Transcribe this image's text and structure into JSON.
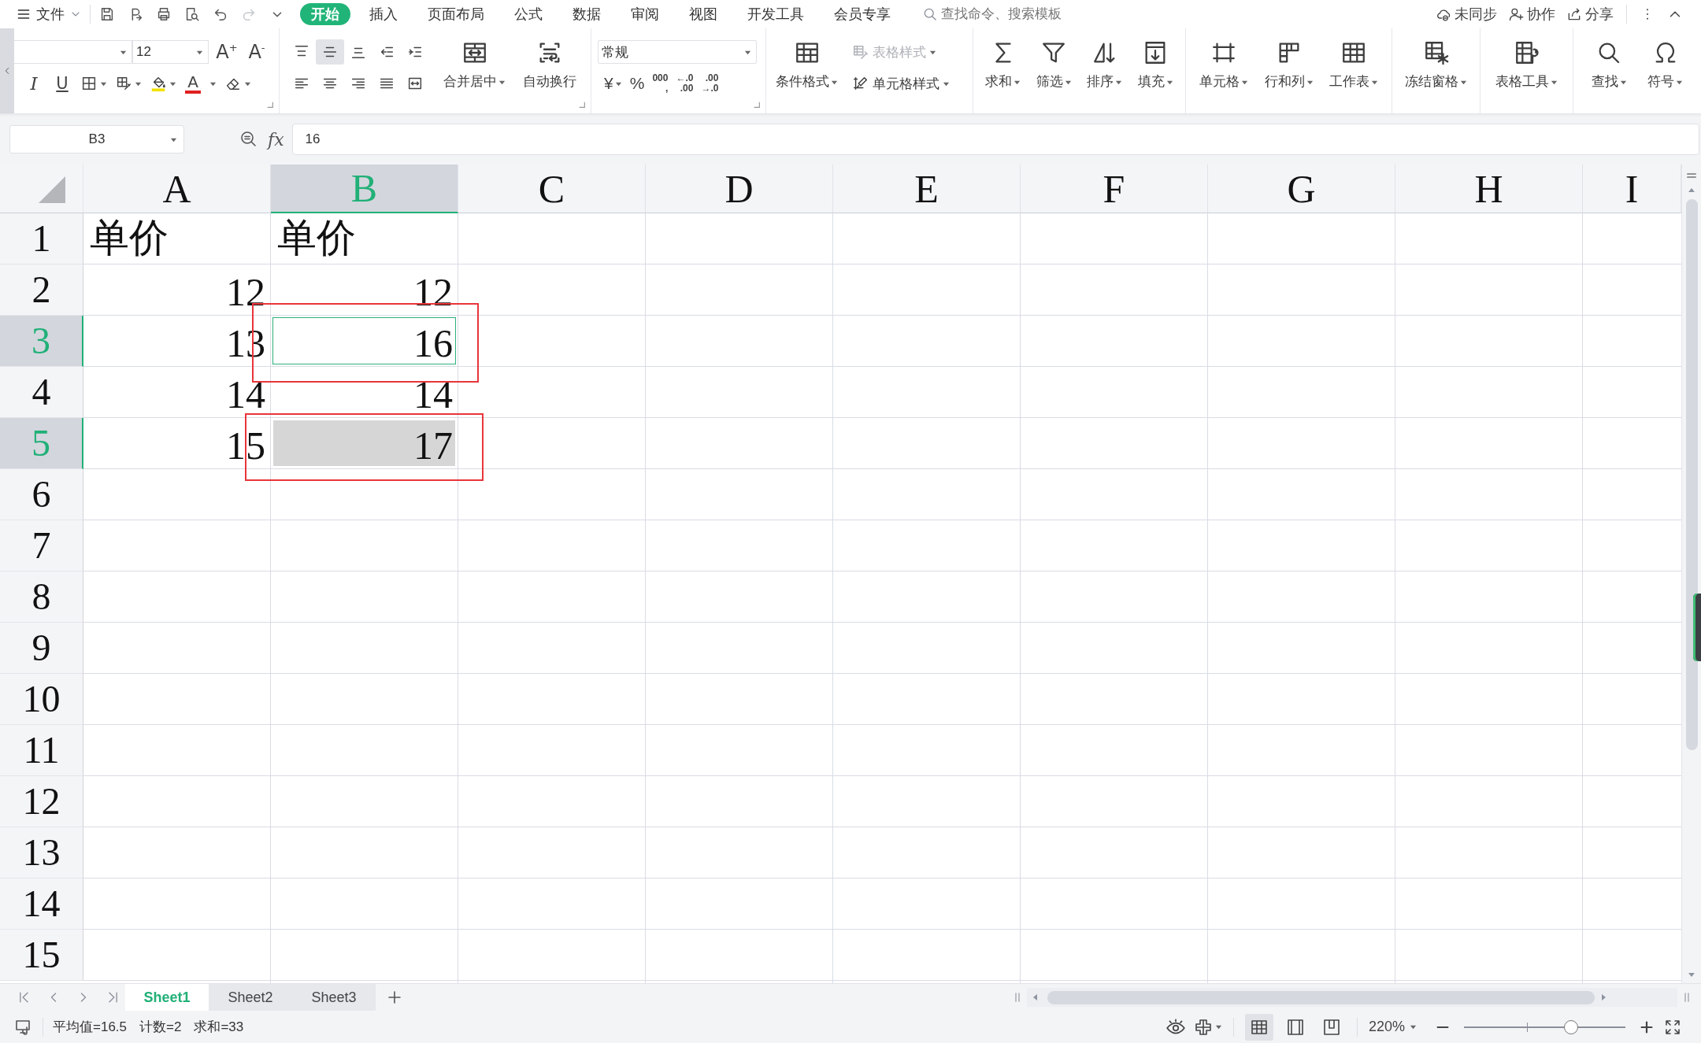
{
  "menu_bar": {
    "menu_label": "文件",
    "quick_access": [
      {
        "disabled": false
      },
      {
        "disabled": false
      },
      {
        "disabled": false
      },
      {
        "disabled": false
      },
      {
        "disabled": false
      },
      {
        "disabled": true
      },
      {
        "disabled": false
      }
    ],
    "tabs": [
      {
        "label": "开始",
        "selected": true
      },
      {
        "label": "插入",
        "selected": false
      },
      {
        "label": "页面布局",
        "selected": false
      },
      {
        "label": "公式",
        "selected": false
      },
      {
        "label": "数据",
        "selected": false
      },
      {
        "label": "审阅",
        "selected": false
      },
      {
        "label": "视图",
        "selected": false
      },
      {
        "label": "开发工具",
        "selected": false
      },
      {
        "label": "会员专享",
        "selected": false
      }
    ],
    "search": {
      "placeholder": "查找命令、搜索模板"
    },
    "actions": [
      {
        "label": "未同步"
      },
      {
        "label": "协作"
      },
      {
        "label": "分享"
      }
    ]
  },
  "ribbon": {
    "font_size": "12",
    "grow_font": "A$^{+}$",
    "shrink_font": "A$^{-}$",
    "italic": "I",
    "underline": "U",
    "font_color": "A",
    "align_buttons": [
      {
        "selected": false
      },
      {
        "selected": true
      },
      {
        "selected": false
      },
      {
        "selected": false
      },
      {
        "selected": false
      },
      {
        "selected": false
      },
      {
        "selected": false
      },
      {
        "selected": false
      },
      {
        "selected": false
      },
      {
        "selected": false
      }
    ],
    "merge_buttons": [
      {
        "label": "合并居中",
        "dropdown": true
      },
      {
        "label": "自动换行",
        "dropdown": false
      }
    ],
    "number_format": "常规",
    "number_buttons": [
      {
        "lines": [
          "¥"
        ],
        "dropdown": true
      },
      {
        "lines": [
          "%"
        ],
        "dropdown": false
      },
      {
        "lines": [
          "000",
          ","
        ],
        "dropdown": false
      },
      {
        "lines": [
          "←.0",
          ".00"
        ],
        "dropdown": false
      },
      {
        "lines": [
          ".00",
          "→.0"
        ],
        "dropdown": false
      }
    ],
    "conditional_format": {
      "label": "条件格式",
      "dropdown": true
    },
    "style_buttons": [
      {
        "label": "表格样式",
        "disabled": true,
        "dropdown": true
      },
      {
        "label": "单元格样式",
        "disabled": false,
        "dropdown": true
      }
    ],
    "tool_groups": [
      [
        {
          "label": "求和",
          "dropdown": true
        },
        {
          "label": "筛选",
          "dropdown": true
        },
        {
          "label": "排序",
          "dropdown": true
        },
        {
          "label": "填充",
          "dropdown": true
        }
      ],
      [
        {
          "label": "单元格",
          "dropdown": true
        },
        {
          "label": "行和列",
          "dropdown": true
        },
        {
          "label": "工作表",
          "dropdown": true
        }
      ],
      [
        {
          "label": "冻结窗格",
          "dropdown": true
        }
      ],
      [
        {
          "label": "表格工具",
          "dropdown": true
        }
      ],
      [
        {
          "label": "查找",
          "dropdown": true
        },
        {
          "label": "符号",
          "dropdown": true
        }
      ]
    ]
  },
  "formula_bar": {
    "name_box": "B3",
    "fx": "fx",
    "value": "16"
  },
  "sheet": {
    "columns": [
      {
        "label": "A",
        "selected": false
      },
      {
        "label": "B",
        "selected": true
      },
      {
        "label": "C",
        "selected": false
      },
      {
        "label": "D",
        "selected": false
      },
      {
        "label": "E",
        "selected": false
      },
      {
        "label": "F",
        "selected": false
      },
      {
        "label": "G",
        "selected": false
      },
      {
        "label": "H",
        "selected": false
      },
      {
        "label": "I",
        "selected": false
      }
    ],
    "rows": [
      {
        "label": "1",
        "selected": false,
        "cells": [
          {
            "value": "单价",
            "kind": "text",
            "selected": false,
            "active": false,
            "highlighted": false
          },
          {
            "value": "单价",
            "kind": "text",
            "selected": false,
            "active": false,
            "highlighted": false
          }
        ]
      },
      {
        "label": "2",
        "selected": false,
        "cells": [
          {
            "value": "12",
            "kind": "number",
            "selected": false,
            "active": false,
            "highlighted": false
          },
          {
            "value": "12",
            "kind": "number",
            "selected": false,
            "active": false,
            "highlighted": false
          }
        ]
      },
      {
        "label": "3",
        "selected": true,
        "cells": [
          {
            "value": "13",
            "kind": "number",
            "selected": false,
            "active": false,
            "highlighted": false
          },
          {
            "value": "16",
            "kind": "number",
            "selected": true,
            "active": true,
            "highlighted": true
          }
        ]
      },
      {
        "label": "4",
        "selected": false,
        "cells": [
          {
            "value": "14",
            "kind": "number",
            "selected": false,
            "active": false,
            "highlighted": false
          },
          {
            "value": "14",
            "kind": "number",
            "selected": false,
            "active": false,
            "highlighted": false
          }
        ]
      },
      {
        "label": "5",
        "selected": true,
        "cells": [
          {
            "value": "15",
            "kind": "number",
            "selected": false,
            "active": false,
            "highlighted": false
          },
          {
            "value": "17",
            "kind": "number",
            "selected": true,
            "active": false,
            "highlighted": true
          }
        ]
      },
      {
        "label": "6",
        "selected": false
      },
      {
        "label": "7",
        "selected": false
      },
      {
        "label": "8",
        "selected": false
      },
      {
        "label": "9",
        "selected": false
      },
      {
        "label": "10",
        "selected": false
      },
      {
        "label": "11",
        "selected": false
      },
      {
        "label": "12",
        "selected": false
      },
      {
        "label": "13",
        "selected": false
      },
      {
        "label": "14",
        "selected": false
      },
      {
        "label": "15",
        "selected": false
      }
    ]
  },
  "sheet_tabs": [
    {
      "label": "Sheet1",
      "selected": true
    },
    {
      "label": "Sheet2",
      "selected": false
    },
    {
      "label": "Sheet3",
      "selected": false
    }
  ],
  "status_bar": {
    "stats": [
      "平均值=16.5",
      "计数=2",
      "求和=33"
    ],
    "view_modes": [
      {
        "selected": true
      },
      {
        "selected": false
      },
      {
        "selected": false
      }
    ],
    "zoom": "220%",
    "zoom_slider": {
      "level": 0.68
    }
  }
}
